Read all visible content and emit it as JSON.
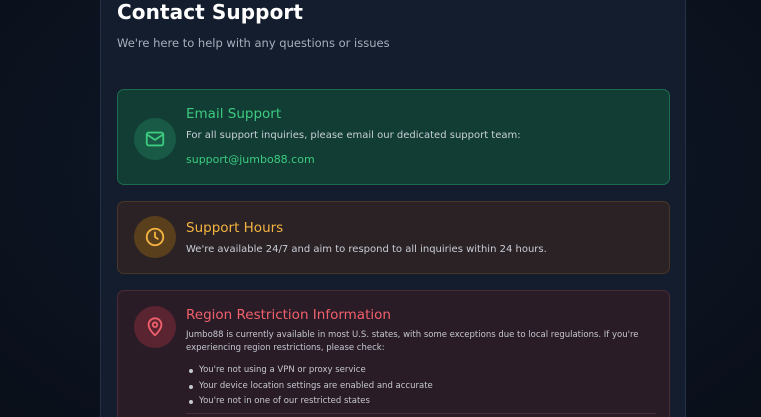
{
  "header": {
    "title": "Contact Support",
    "subtitle": "We're here to help with any questions or issues"
  },
  "email_card": {
    "icon": "mail-icon",
    "title": "Email Support",
    "text": "For all support inquiries, please email our dedicated support team:",
    "email": "support@jumbo88.com",
    "accent": "#3ccb7f"
  },
  "hours_card": {
    "icon": "clock-icon",
    "title": "Support Hours",
    "text": "We're available 24/7 and aim to respond to all inquiries within 24 hours.",
    "accent": "#f5b342"
  },
  "region_card": {
    "icon": "location-pin-icon",
    "title": "Region Restriction Information",
    "text": "Jumbo88 is currently available in most U.S. states, with some exceptions due to local regulations. If you're experiencing region restrictions, please check:",
    "items": [
      "You're not using a VPN or proxy service",
      "Your device location settings are enabled and accurate",
      "You're not in one of our restricted states"
    ],
    "accent": "#f0606c"
  }
}
